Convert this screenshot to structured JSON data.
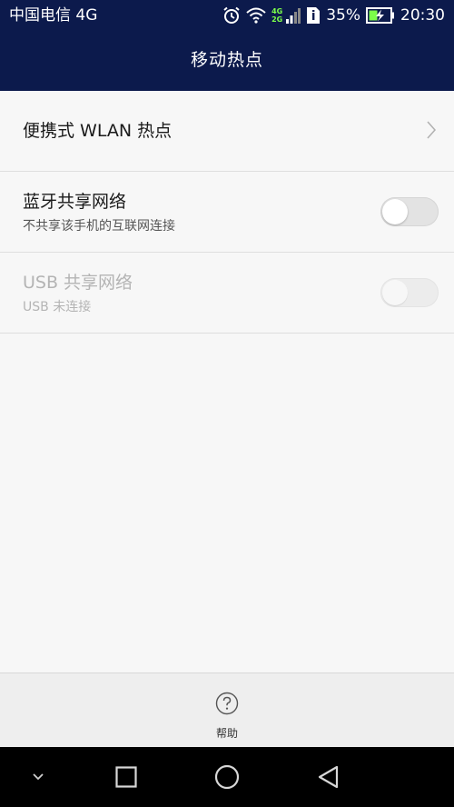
{
  "status_bar": {
    "carrier": "中国电信 4G",
    "net_tag_top": "4G",
    "net_tag_bottom": "2G",
    "battery_percent": "35%",
    "time": "20:30"
  },
  "header": {
    "title": "移动热点"
  },
  "settings": [
    {
      "label": "便携式 WLAN 热点"
    },
    {
      "label": "蓝牙共享网络",
      "subtitle": "不共享该手机的互联网连接",
      "toggle_on": false
    },
    {
      "label": "USB 共享网络",
      "subtitle": "USB 未连接",
      "toggle_on": false,
      "disabled": true
    }
  ],
  "bottom": {
    "help_label": "帮助"
  },
  "colors": {
    "header_bg": "#0c1a4c",
    "page_bg": "#f7f7f7",
    "battery_charging": "#7cff4a"
  }
}
